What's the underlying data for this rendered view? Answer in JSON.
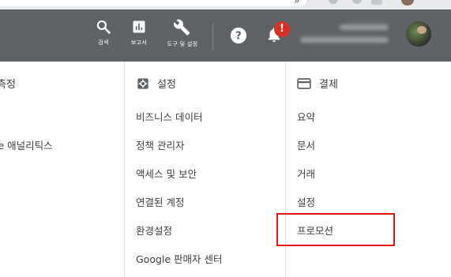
{
  "toolbar": {
    "search_label": "검색",
    "reports_label": "보고서",
    "tools_label": "도구 및 설정",
    "notification_count": "!"
  },
  "columns": {
    "measurement": {
      "title": "측정",
      "items": [
        "le 애널리틱스"
      ]
    },
    "setup": {
      "title": "설정",
      "items": [
        "비즈니스 데이터",
        "정책 관리자",
        "액세스 및 보안",
        "연결된 계정",
        "환경설정",
        "Google 판매자 센터"
      ]
    },
    "billing": {
      "title": "결제",
      "items": [
        "요약",
        "문서",
        "거래",
        "설정",
        "프로모션"
      ]
    }
  },
  "colors": {
    "header_bg": "#5f6368",
    "highlight": "#e01616",
    "badge": "#d93025"
  }
}
